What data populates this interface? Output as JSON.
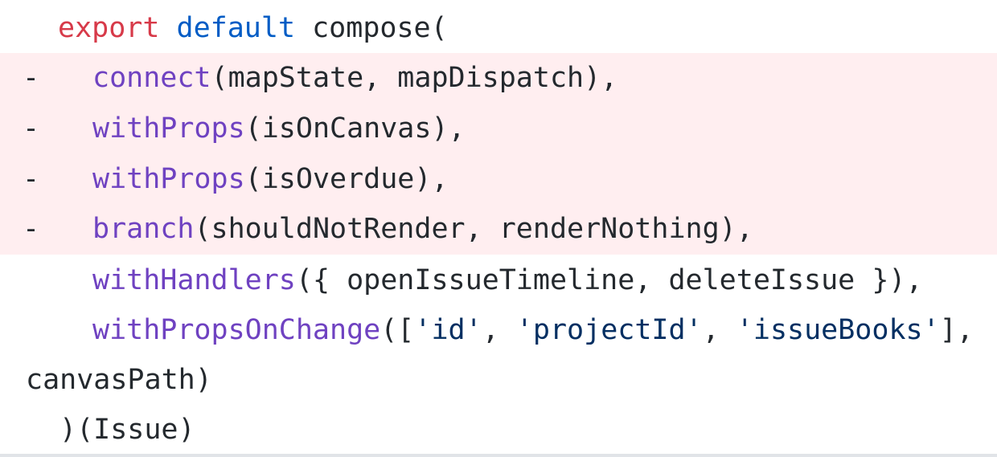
{
  "diff": {
    "removed_marker": "-",
    "lines": [
      {
        "kind": "context",
        "tokens": [
          {
            "t": "export",
            "c": "kw-red"
          },
          {
            "t": " ",
            "c": "plain"
          },
          {
            "t": "default",
            "c": "kw-blue"
          },
          {
            "t": " compose(",
            "c": "plain"
          }
        ]
      },
      {
        "kind": "removed",
        "tokens": [
          {
            "t": "connect",
            "c": "fn"
          },
          {
            "t": "(mapState, mapDispatch),",
            "c": "plain"
          }
        ]
      },
      {
        "kind": "removed",
        "tokens": [
          {
            "t": "withProps",
            "c": "fn"
          },
          {
            "t": "(isOnCanvas),",
            "c": "plain"
          }
        ]
      },
      {
        "kind": "removed",
        "tokens": [
          {
            "t": "withProps",
            "c": "fn"
          },
          {
            "t": "(isOverdue),",
            "c": "plain"
          }
        ]
      },
      {
        "kind": "removed",
        "tokens": [
          {
            "t": "branch",
            "c": "fn"
          },
          {
            "t": "(shouldNotRender, renderNothing),",
            "c": "plain"
          }
        ]
      },
      {
        "kind": "context",
        "tokens": [
          {
            "t": "withHandlers",
            "c": "fn"
          },
          {
            "t": "({ openIssueTimeline, deleteIssue }),",
            "c": "plain"
          }
        ]
      },
      {
        "kind": "context",
        "tokens": [
          {
            "t": "withPropsOnChange",
            "c": "fn"
          },
          {
            "t": "([",
            "c": "plain"
          },
          {
            "t": "'id'",
            "c": "str"
          },
          {
            "t": ", ",
            "c": "plain"
          },
          {
            "t": "'projectId'",
            "c": "str"
          },
          {
            "t": ", ",
            "c": "plain"
          },
          {
            "t": "'issueBooks'",
            "c": "str"
          },
          {
            "t": "],",
            "c": "plain"
          }
        ]
      },
      {
        "kind": "context",
        "tokens": [
          {
            "t": "canvasPath)",
            "c": "plain"
          }
        ]
      },
      {
        "kind": "context",
        "tokens": [
          {
            "t": ")(Issue)",
            "c": "plain"
          }
        ]
      }
    ]
  },
  "colors": {
    "removed_bg": "#ffeef0",
    "keyword_red": "#d73a49",
    "keyword_blue": "#005cc5",
    "function": "#6f42c1",
    "string": "#032f62",
    "text": "#24292e"
  }
}
